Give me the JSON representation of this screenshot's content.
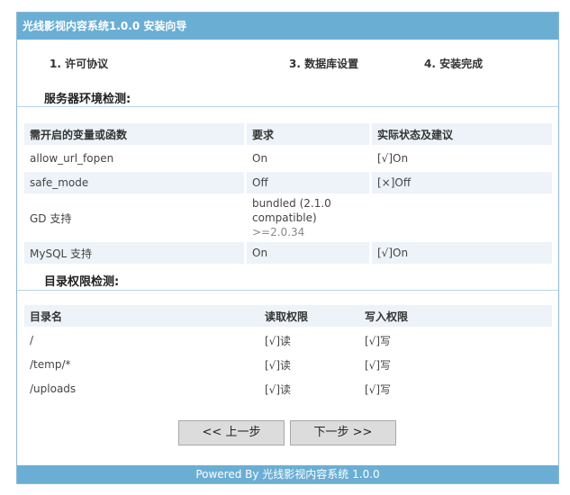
{
  "header": {
    "title": "光线影视内容系统1.0.0 安装向导"
  },
  "steps": [
    "1. 许可协议",
    "3. 数据库设置",
    "4. 安装完成"
  ],
  "env": {
    "title": "服务器环境检测:",
    "columns": [
      "需开启的变量或函数",
      "要求",
      "实际状态及建议"
    ],
    "rows": [
      {
        "name": "allow_url_fopen",
        "req": "On",
        "status": "[√]On"
      },
      {
        "name": "safe_mode",
        "req": "Off",
        "status": "[×]Off"
      },
      {
        "name": "GD 支持",
        "req_line1": "bundled (2.1.0",
        "req_line2": "compatible)",
        "req_note": ">=2.0.34",
        "status": ""
      },
      {
        "name": "MySQL 支持",
        "req": "On",
        "status": "[√]On"
      }
    ]
  },
  "dirs": {
    "title": "目录权限检测:",
    "columns": [
      "目录名",
      "读取权限",
      "写入权限"
    ],
    "rows": [
      {
        "name": "/",
        "read": "[√]读",
        "write": "[√]写"
      },
      {
        "name": "/temp/*",
        "read": "[√]读",
        "write": "[√]写"
      },
      {
        "name": "/uploads",
        "read": "[√]读",
        "write": "[√]写"
      }
    ]
  },
  "buttons": {
    "prev": "<< 上一步",
    "next": "下一步 >>"
  },
  "footer": {
    "text": "Powered By 光线影视内容系统 1.0.0"
  },
  "colors": {
    "accent": "#6aaed4",
    "ok": "#1e9a1e",
    "row_bg": "#edf3f8"
  }
}
